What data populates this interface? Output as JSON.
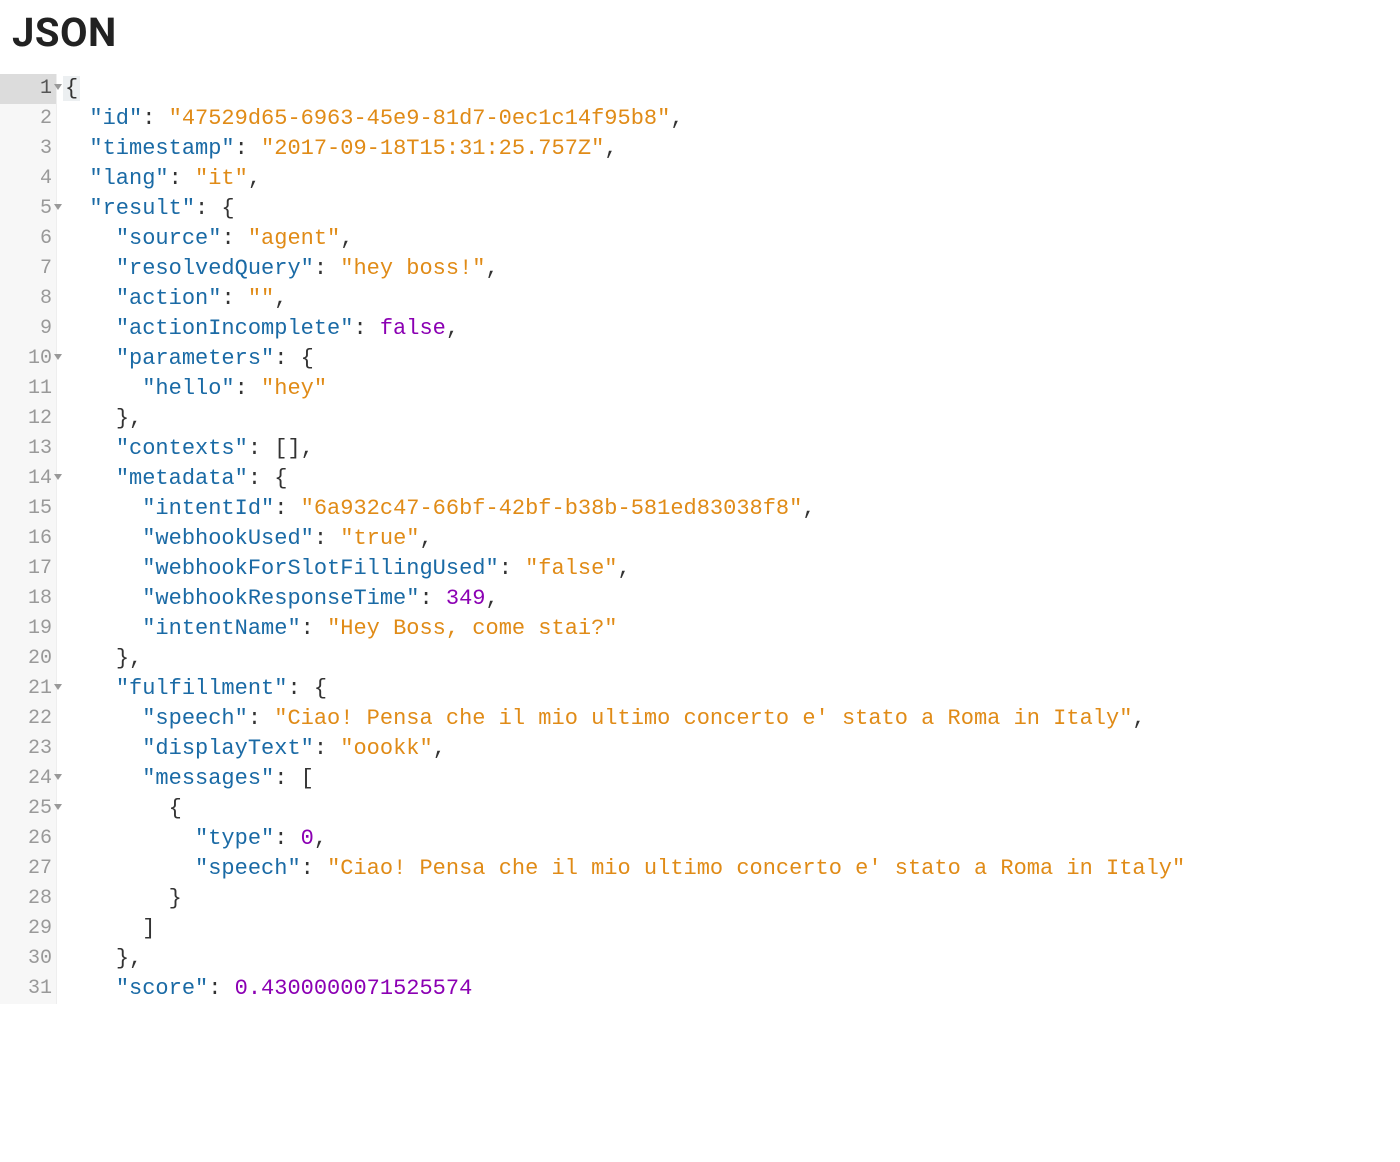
{
  "title": "JSON",
  "lines": [
    {
      "num": "1",
      "fold": "open",
      "active": true,
      "tokens": [
        {
          "t": "p",
          "v": "{"
        }
      ]
    },
    {
      "num": "2",
      "tokens": [
        {
          "t": "pad",
          "v": "  "
        },
        {
          "t": "k",
          "v": "\"id\""
        },
        {
          "t": "p",
          "v": ": "
        },
        {
          "t": "s",
          "v": "\"47529d65-6963-45e9-81d7-0ec1c14f95b8\""
        },
        {
          "t": "p",
          "v": ","
        }
      ]
    },
    {
      "num": "3",
      "tokens": [
        {
          "t": "pad",
          "v": "  "
        },
        {
          "t": "k",
          "v": "\"timestamp\""
        },
        {
          "t": "p",
          "v": ": "
        },
        {
          "t": "s",
          "v": "\"2017-09-18T15:31:25.757Z\""
        },
        {
          "t": "p",
          "v": ","
        }
      ]
    },
    {
      "num": "4",
      "tokens": [
        {
          "t": "pad",
          "v": "  "
        },
        {
          "t": "k",
          "v": "\"lang\""
        },
        {
          "t": "p",
          "v": ": "
        },
        {
          "t": "s",
          "v": "\"it\""
        },
        {
          "t": "p",
          "v": ","
        }
      ]
    },
    {
      "num": "5",
      "fold": "open",
      "tokens": [
        {
          "t": "pad",
          "v": "  "
        },
        {
          "t": "k",
          "v": "\"result\""
        },
        {
          "t": "p",
          "v": ": {"
        }
      ]
    },
    {
      "num": "6",
      "tokens": [
        {
          "t": "pad",
          "v": "    "
        },
        {
          "t": "k",
          "v": "\"source\""
        },
        {
          "t": "p",
          "v": ": "
        },
        {
          "t": "s",
          "v": "\"agent\""
        },
        {
          "t": "p",
          "v": ","
        }
      ]
    },
    {
      "num": "7",
      "tokens": [
        {
          "t": "pad",
          "v": "    "
        },
        {
          "t": "k",
          "v": "\"resolvedQuery\""
        },
        {
          "t": "p",
          "v": ": "
        },
        {
          "t": "s",
          "v": "\"hey boss!\""
        },
        {
          "t": "p",
          "v": ","
        }
      ]
    },
    {
      "num": "8",
      "tokens": [
        {
          "t": "pad",
          "v": "    "
        },
        {
          "t": "k",
          "v": "\"action\""
        },
        {
          "t": "p",
          "v": ": "
        },
        {
          "t": "s",
          "v": "\"\""
        },
        {
          "t": "p",
          "v": ","
        }
      ]
    },
    {
      "num": "9",
      "tokens": [
        {
          "t": "pad",
          "v": "    "
        },
        {
          "t": "k",
          "v": "\"actionIncomplete\""
        },
        {
          "t": "p",
          "v": ": "
        },
        {
          "t": "b",
          "v": "false"
        },
        {
          "t": "p",
          "v": ","
        }
      ]
    },
    {
      "num": "10",
      "fold": "open",
      "tokens": [
        {
          "t": "pad",
          "v": "    "
        },
        {
          "t": "k",
          "v": "\"parameters\""
        },
        {
          "t": "p",
          "v": ": {"
        }
      ]
    },
    {
      "num": "11",
      "tokens": [
        {
          "t": "pad",
          "v": "      "
        },
        {
          "t": "k",
          "v": "\"hello\""
        },
        {
          "t": "p",
          "v": ": "
        },
        {
          "t": "s",
          "v": "\"hey\""
        }
      ]
    },
    {
      "num": "12",
      "tokens": [
        {
          "t": "pad",
          "v": "    "
        },
        {
          "t": "p",
          "v": "},"
        }
      ]
    },
    {
      "num": "13",
      "tokens": [
        {
          "t": "pad",
          "v": "    "
        },
        {
          "t": "k",
          "v": "\"contexts\""
        },
        {
          "t": "p",
          "v": ": [],"
        }
      ]
    },
    {
      "num": "14",
      "fold": "open",
      "tokens": [
        {
          "t": "pad",
          "v": "    "
        },
        {
          "t": "k",
          "v": "\"metadata\""
        },
        {
          "t": "p",
          "v": ": {"
        }
      ]
    },
    {
      "num": "15",
      "tokens": [
        {
          "t": "pad",
          "v": "      "
        },
        {
          "t": "k",
          "v": "\"intentId\""
        },
        {
          "t": "p",
          "v": ": "
        },
        {
          "t": "s",
          "v": "\"6a932c47-66bf-42bf-b38b-581ed83038f8\""
        },
        {
          "t": "p",
          "v": ","
        }
      ]
    },
    {
      "num": "16",
      "tokens": [
        {
          "t": "pad",
          "v": "      "
        },
        {
          "t": "k",
          "v": "\"webhookUsed\""
        },
        {
          "t": "p",
          "v": ": "
        },
        {
          "t": "s",
          "v": "\"true\""
        },
        {
          "t": "p",
          "v": ","
        }
      ]
    },
    {
      "num": "17",
      "tokens": [
        {
          "t": "pad",
          "v": "      "
        },
        {
          "t": "k",
          "v": "\"webhookForSlotFillingUsed\""
        },
        {
          "t": "p",
          "v": ": "
        },
        {
          "t": "s",
          "v": "\"false\""
        },
        {
          "t": "p",
          "v": ","
        }
      ]
    },
    {
      "num": "18",
      "tokens": [
        {
          "t": "pad",
          "v": "      "
        },
        {
          "t": "k",
          "v": "\"webhookResponseTime\""
        },
        {
          "t": "p",
          "v": ": "
        },
        {
          "t": "n",
          "v": "349"
        },
        {
          "t": "p",
          "v": ","
        }
      ]
    },
    {
      "num": "19",
      "tokens": [
        {
          "t": "pad",
          "v": "      "
        },
        {
          "t": "k",
          "v": "\"intentName\""
        },
        {
          "t": "p",
          "v": ": "
        },
        {
          "t": "s",
          "v": "\"Hey Boss, come stai?\""
        }
      ]
    },
    {
      "num": "20",
      "tokens": [
        {
          "t": "pad",
          "v": "    "
        },
        {
          "t": "p",
          "v": "},"
        }
      ]
    },
    {
      "num": "21",
      "fold": "open",
      "tokens": [
        {
          "t": "pad",
          "v": "    "
        },
        {
          "t": "k",
          "v": "\"fulfillment\""
        },
        {
          "t": "p",
          "v": ": {"
        }
      ]
    },
    {
      "num": "22",
      "tokens": [
        {
          "t": "pad",
          "v": "      "
        },
        {
          "t": "k",
          "v": "\"speech\""
        },
        {
          "t": "p",
          "v": ": "
        },
        {
          "t": "s",
          "v": "\"Ciao! Pensa che il mio ultimo concerto e' stato a Roma in Italy\""
        },
        {
          "t": "p",
          "v": ","
        }
      ]
    },
    {
      "num": "23",
      "tokens": [
        {
          "t": "pad",
          "v": "      "
        },
        {
          "t": "k",
          "v": "\"displayText\""
        },
        {
          "t": "p",
          "v": ": "
        },
        {
          "t": "s",
          "v": "\"oookk\""
        },
        {
          "t": "p",
          "v": ","
        }
      ]
    },
    {
      "num": "24",
      "fold": "open",
      "tokens": [
        {
          "t": "pad",
          "v": "      "
        },
        {
          "t": "k",
          "v": "\"messages\""
        },
        {
          "t": "p",
          "v": ": ["
        }
      ]
    },
    {
      "num": "25",
      "fold": "open",
      "tokens": [
        {
          "t": "pad",
          "v": "        "
        },
        {
          "t": "p",
          "v": "{"
        }
      ]
    },
    {
      "num": "26",
      "tokens": [
        {
          "t": "pad",
          "v": "          "
        },
        {
          "t": "k",
          "v": "\"type\""
        },
        {
          "t": "p",
          "v": ": "
        },
        {
          "t": "n",
          "v": "0"
        },
        {
          "t": "p",
          "v": ","
        }
      ]
    },
    {
      "num": "27",
      "tokens": [
        {
          "t": "pad",
          "v": "          "
        },
        {
          "t": "k",
          "v": "\"speech\""
        },
        {
          "t": "p",
          "v": ": "
        },
        {
          "t": "s",
          "v": "\"Ciao! Pensa che il mio ultimo concerto e' stato a Roma in Italy\""
        }
      ]
    },
    {
      "num": "28",
      "tokens": [
        {
          "t": "pad",
          "v": "        "
        },
        {
          "t": "p",
          "v": "}"
        }
      ]
    },
    {
      "num": "29",
      "tokens": [
        {
          "t": "pad",
          "v": "      "
        },
        {
          "t": "p",
          "v": "]"
        }
      ]
    },
    {
      "num": "30",
      "tokens": [
        {
          "t": "pad",
          "v": "    "
        },
        {
          "t": "p",
          "v": "},"
        }
      ]
    },
    {
      "num": "31",
      "tokens": [
        {
          "t": "pad",
          "v": "    "
        },
        {
          "t": "k",
          "v": "\"score\""
        },
        {
          "t": "p",
          "v": ": "
        },
        {
          "t": "n",
          "v": "0.4300000071525574"
        }
      ]
    }
  ]
}
